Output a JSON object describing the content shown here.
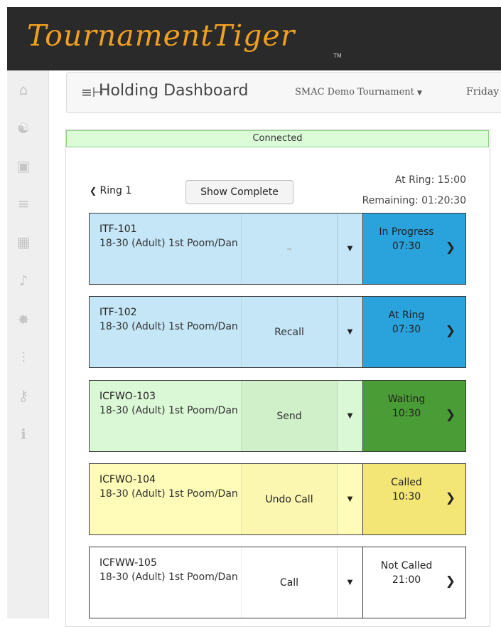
{
  "app": {
    "brand": "TournamentTiger",
    "brand_tm": "TM"
  },
  "sidebar": {
    "items": [
      {
        "icon": "home-icon",
        "glyph": "⌂"
      },
      {
        "icon": "yin-yang-icon",
        "glyph": "☯"
      },
      {
        "icon": "id-card-icon",
        "glyph": "▣"
      },
      {
        "icon": "holding-icon",
        "glyph": "≡"
      },
      {
        "icon": "table-icon",
        "glyph": "▦"
      },
      {
        "icon": "music-note-icon",
        "glyph": "♪"
      },
      {
        "icon": "gear-icon",
        "glyph": "✹"
      },
      {
        "icon": "sliders-icon",
        "glyph": "⫶"
      },
      {
        "icon": "key-icon",
        "glyph": "⚷"
      },
      {
        "icon": "info-icon",
        "glyph": "ℹ"
      }
    ]
  },
  "header": {
    "title": "Holding Dashboard",
    "tournament": "SMAC Demo Tournament",
    "day": "Friday"
  },
  "status": {
    "connected": "Connected"
  },
  "ring": {
    "back_label": "Ring 1",
    "show_complete": "Show Complete",
    "at_ring": "At Ring: 15:00",
    "remaining": "Remaining: 01:20:30"
  },
  "matches": [
    {
      "id": "ITF-101",
      "division": "18-30 (Adult) 1st Poom/Dan",
      "action": "–",
      "status": "In Progress",
      "time": "07:30"
    },
    {
      "id": "ITF-102",
      "division": "18-30 (Adult) 1st Poom/Dan",
      "action": "Recall",
      "status": "At Ring",
      "time": "07:30"
    },
    {
      "id": "ICFWO-103",
      "division": "18-30 (Adult) 1st Poom/Dan",
      "action": "Send",
      "status": "Waiting",
      "time": "10:30"
    },
    {
      "id": "ICFWO-104",
      "division": "18-30 (Adult) 1st Poom/Dan",
      "action": "Undo Call",
      "status": "Called",
      "time": "10:30"
    },
    {
      "id": "ICFWW-105",
      "division": "18-30 (Adult) 1st Poom/Dan",
      "action": "Call",
      "status": "Not Called",
      "time": "21:00"
    }
  ]
}
